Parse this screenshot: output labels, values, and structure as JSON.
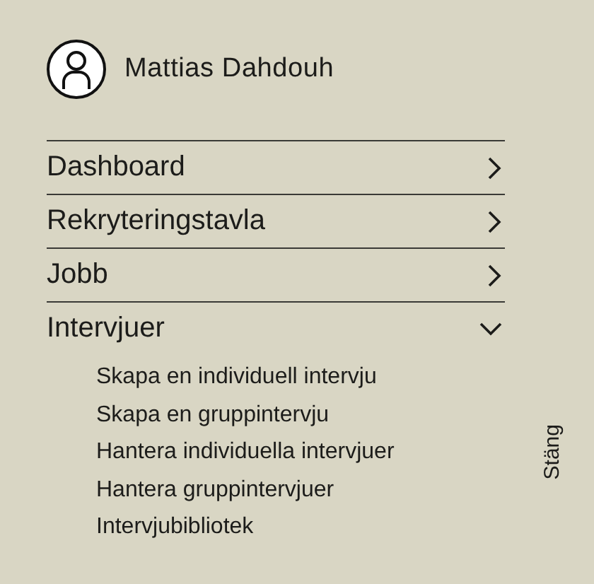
{
  "user": {
    "name": "Mattias Dahdouh"
  },
  "menu": [
    {
      "label": "Dashboard",
      "expanded": false
    },
    {
      "label": "Rekryteringstavla",
      "expanded": false
    },
    {
      "label": "Jobb",
      "expanded": false
    },
    {
      "label": "Intervjuer",
      "expanded": true,
      "children": [
        {
          "label": "Skapa en individuell intervju"
        },
        {
          "label": "Skapa en gruppintervju"
        },
        {
          "label": "Hantera individuella intervjuer"
        },
        {
          "label": "Hantera gruppintervjuer"
        },
        {
          "label": "Intervjubibliotek"
        }
      ]
    }
  ],
  "close_label": "Stäng"
}
